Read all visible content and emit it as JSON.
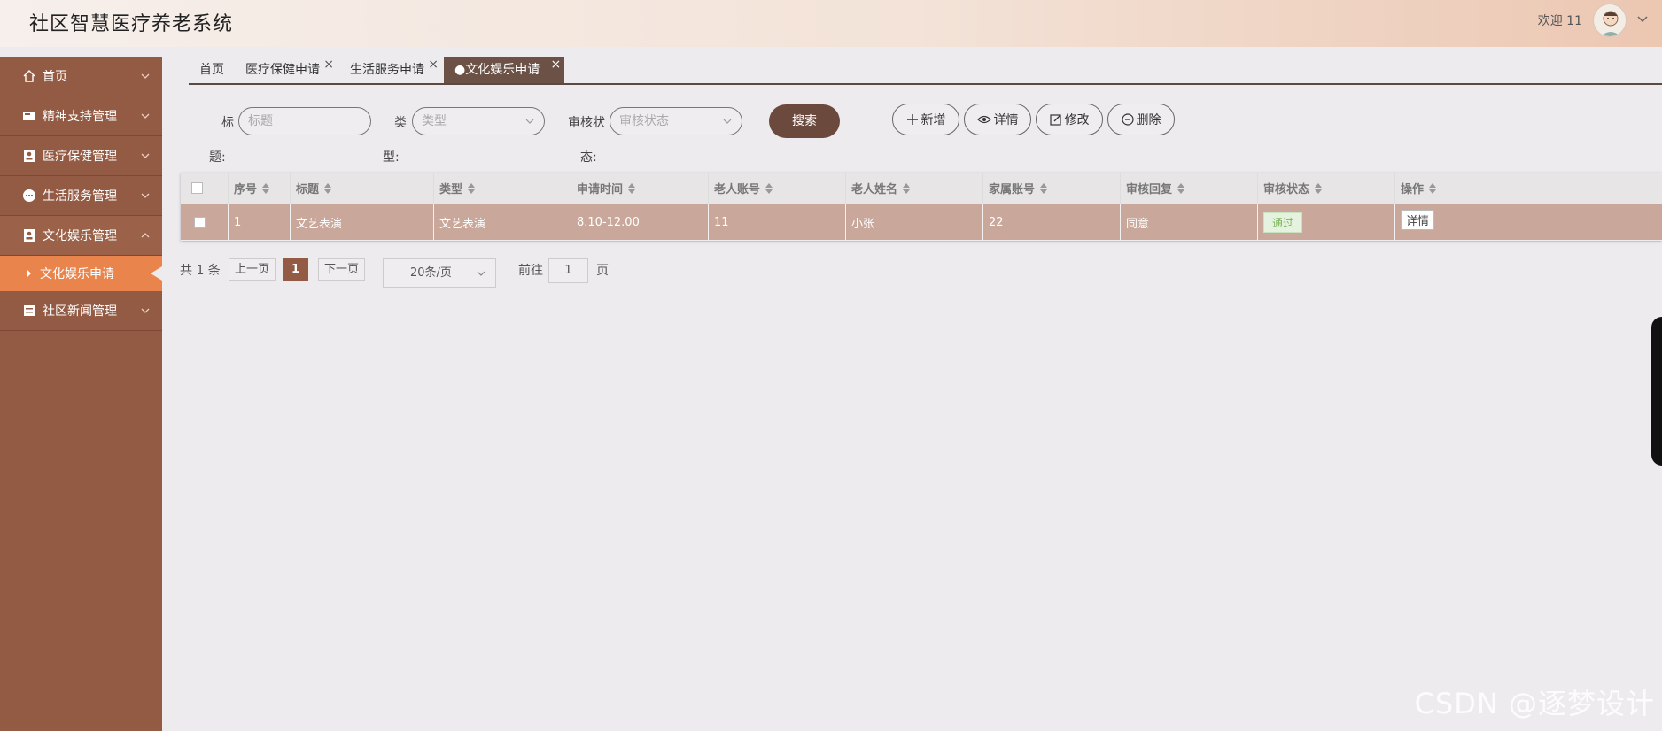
{
  "header": {
    "app_title": "社区智慧医疗养老系统",
    "welcome": "欢迎 11"
  },
  "sidebar": {
    "items": [
      {
        "label": "首页",
        "icon": "home-icon"
      },
      {
        "label": "精神支持管理",
        "icon": "folder-icon"
      },
      {
        "label": "医疗保健管理",
        "icon": "person-card-icon"
      },
      {
        "label": "生活服务管理",
        "icon": "dots-icon"
      },
      {
        "label": "文化娱乐管理",
        "icon": "person-card-icon",
        "expanded": true
      },
      {
        "label": "社区新闻管理",
        "icon": "list-icon"
      }
    ],
    "sub_item": {
      "label": "文化娱乐申请"
    }
  },
  "tabs": [
    {
      "label": "首页"
    },
    {
      "label": "医疗保健申请"
    },
    {
      "label": "生活服务申请"
    },
    {
      "label": "●文化娱乐申请",
      "active": true
    }
  ],
  "search": {
    "title_label_a": "标",
    "title_label_b": "题:",
    "title_placeholder": "标题",
    "type_label_a": "类",
    "type_label_b": "型:",
    "type_placeholder": "类型",
    "status_label_a": "审核状",
    "status_label_b": "态:",
    "status_placeholder": "审核状态",
    "search_button": "搜索"
  },
  "toolbar": {
    "add": "新增",
    "detail": "详情",
    "edit": "修改",
    "delete": "删除"
  },
  "table": {
    "columns": [
      "序号",
      "标题",
      "类型",
      "申请时间",
      "老人账号",
      "老人姓名",
      "家属账号",
      "审核回复",
      "审核状态",
      "操作"
    ],
    "rows": [
      {
        "index": "1",
        "title": "文艺表演",
        "type": "文艺表演",
        "apply_time": "8.10-12.00",
        "elder_account": "11",
        "elder_name": "小张",
        "family_account": "22",
        "reply": "同意",
        "status": "通过",
        "action": "详情"
      }
    ]
  },
  "pagination": {
    "total": "共 1 条",
    "prev": "上一页",
    "current": "1",
    "next": "下一页",
    "page_size": "20条/页",
    "goto_label": "前往",
    "goto_value": "1",
    "page_suffix": "页"
  },
  "watermark": "CSDN @逐梦设计",
  "colors": {
    "sidebar": "#945b44",
    "sidebar_active_sub": "#e8844c",
    "tab_active": "#6b5146",
    "row_bg": "#c9a89b",
    "search_button": "#6b4a3d"
  }
}
